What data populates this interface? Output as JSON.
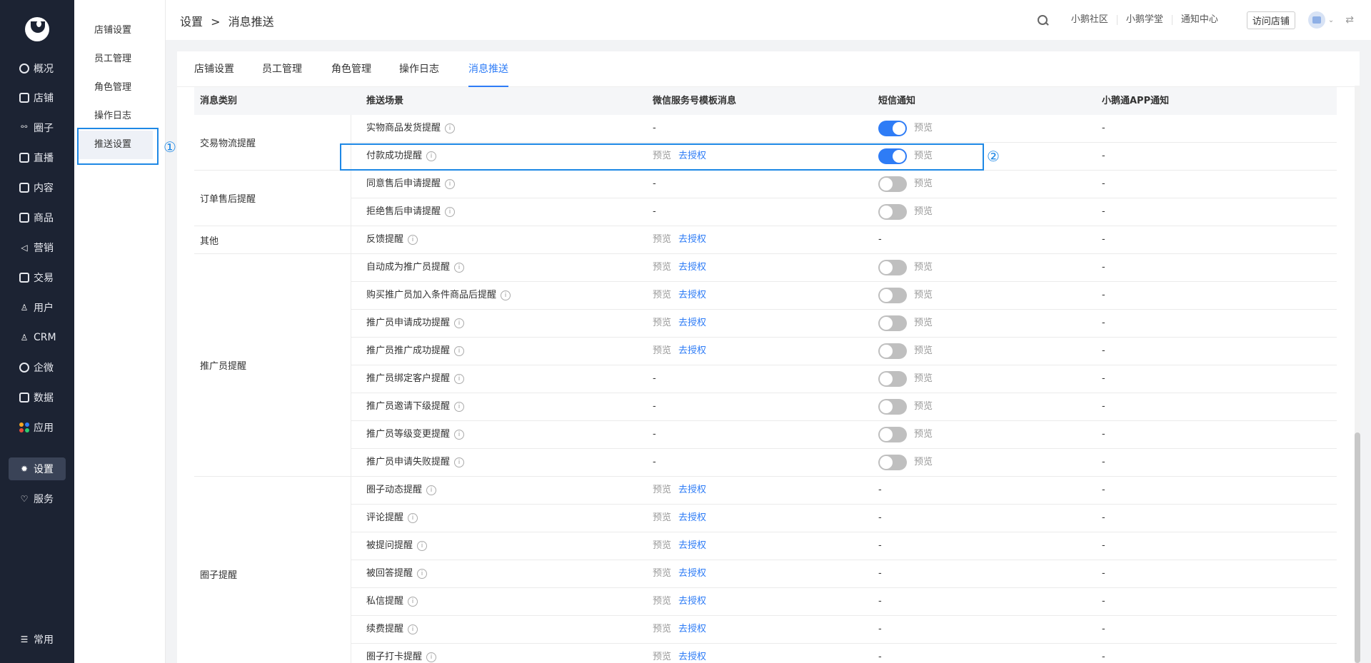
{
  "sidebar": {
    "items": [
      {
        "label": "概况",
        "icon": "overview-icon"
      },
      {
        "label": "店铺",
        "icon": "store-icon"
      },
      {
        "label": "圈子",
        "icon": "circle-icon"
      },
      {
        "label": "直播",
        "icon": "live-icon"
      },
      {
        "label": "内容",
        "icon": "content-icon"
      },
      {
        "label": "商品",
        "icon": "goods-icon"
      },
      {
        "label": "营销",
        "icon": "marketing-icon"
      },
      {
        "label": "交易",
        "icon": "trade-icon"
      },
      {
        "label": "用户",
        "icon": "user-icon"
      },
      {
        "label": "CRM",
        "icon": "crm-icon"
      },
      {
        "label": "企微",
        "icon": "wecom-icon"
      },
      {
        "label": "数据",
        "icon": "data-icon"
      },
      {
        "label": "应用",
        "icon": "apps-icon"
      },
      {
        "label": "设置",
        "icon": "gear-icon"
      },
      {
        "label": "服务",
        "icon": "service-icon"
      }
    ],
    "bottom_label": "常用"
  },
  "submenu": {
    "items": [
      "店铺设置",
      "员工管理",
      "角色管理",
      "操作日志",
      "推送设置"
    ],
    "active": "推送设置"
  },
  "annotations": {
    "one": "①",
    "two": "②"
  },
  "header": {
    "breadcrumb_parent": "设置",
    "breadcrumb_sep": ">",
    "breadcrumb_current": "消息推送",
    "links": [
      "小鹅社区",
      "小鹅学堂",
      "通知中心"
    ],
    "visit_button": "访问店铺"
  },
  "tabs": [
    "店铺设置",
    "员工管理",
    "角色管理",
    "操作日志",
    "消息推送"
  ],
  "active_tab": "消息推送",
  "table": {
    "headers": [
      "消息类别",
      "推送场景",
      "微信服务号模板消息",
      "短信通知",
      "小鹅通APP通知"
    ],
    "preview_label": "预览",
    "authorize_label": "去授权",
    "dash": "-",
    "categories": [
      {
        "label": "交易物流提醒",
        "rows": 2
      },
      {
        "label": "订单售后提醒",
        "rows": 2
      },
      {
        "label": "其他",
        "rows": 1
      },
      {
        "label": "推广员提醒",
        "rows": 8
      },
      {
        "label": "圈子提醒",
        "rows": 7
      }
    ],
    "rows": [
      {
        "scene": "实物商品发货提醒",
        "wechat": "dash",
        "sms": "on",
        "app": "-"
      },
      {
        "scene": "付款成功提醒",
        "wechat": "auth",
        "sms": "on",
        "app": "-"
      },
      {
        "scene": "同意售后申请提醒",
        "wechat": "dash",
        "sms": "off",
        "app": "-"
      },
      {
        "scene": "拒绝售后申请提醒",
        "wechat": "dash",
        "sms": "off",
        "app": "-"
      },
      {
        "scene": "反馈提醒",
        "wechat": "auth",
        "sms": "dash",
        "app": "-"
      },
      {
        "scene": "自动成为推广员提醒",
        "wechat": "auth",
        "sms": "off",
        "app": "-"
      },
      {
        "scene": "购买推广员加入条件商品后提醒",
        "wechat": "auth",
        "sms": "off",
        "app": "-"
      },
      {
        "scene": "推广员申请成功提醒",
        "wechat": "auth",
        "sms": "off",
        "app": "-"
      },
      {
        "scene": "推广员推广成功提醒",
        "wechat": "auth",
        "sms": "off",
        "app": "-"
      },
      {
        "scene": "推广员绑定客户提醒",
        "wechat": "dash",
        "sms": "off",
        "app": "-"
      },
      {
        "scene": "推广员邀请下级提醒",
        "wechat": "dash",
        "sms": "off",
        "app": "-"
      },
      {
        "scene": "推广员等级变更提醒",
        "wechat": "dash",
        "sms": "off",
        "app": "-"
      },
      {
        "scene": "推广员申请失败提醒",
        "wechat": "dash",
        "sms": "off",
        "app": "-"
      },
      {
        "scene": "圈子动态提醒",
        "wechat": "auth",
        "sms": "dash",
        "app": "-"
      },
      {
        "scene": "评论提醒",
        "wechat": "auth",
        "sms": "dash",
        "app": "-"
      },
      {
        "scene": "被提问提醒",
        "wechat": "auth",
        "sms": "dash",
        "app": "-"
      },
      {
        "scene": "被回答提醒",
        "wechat": "auth",
        "sms": "dash",
        "app": "-"
      },
      {
        "scene": "私信提醒",
        "wechat": "auth",
        "sms": "dash",
        "app": "-"
      },
      {
        "scene": "续费提醒",
        "wechat": "auth",
        "sms": "dash",
        "app": "-"
      },
      {
        "scene": "圈子打卡提醒",
        "wechat": "auth",
        "sms": "dash",
        "app": "-"
      }
    ]
  },
  "colors": {
    "accent": "#2e7cf6",
    "highlight": "#1e88e5",
    "sidebar_bg": "#1c2333"
  }
}
